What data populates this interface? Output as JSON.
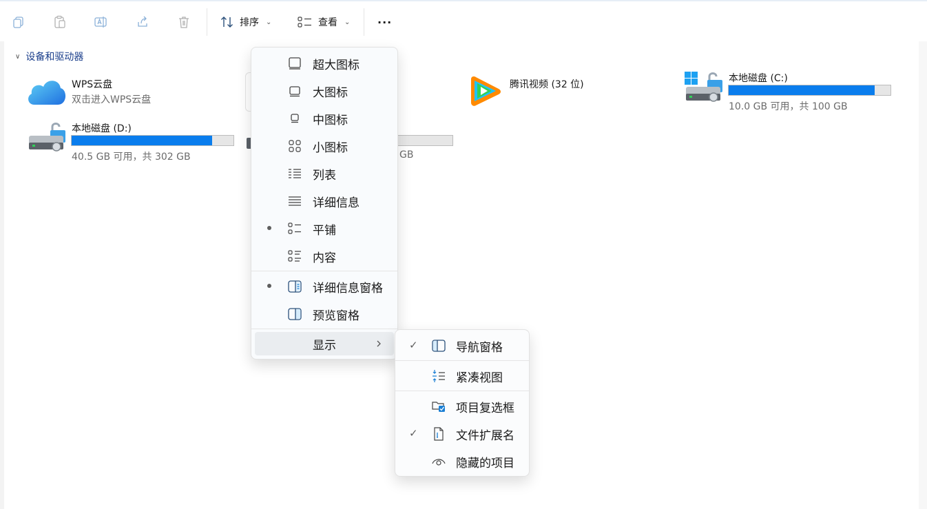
{
  "toolbar": {
    "sort_label": "排序",
    "view_label": "查看",
    "more_label": "···"
  },
  "section": {
    "title": "设备和驱动器"
  },
  "drives": [
    {
      "name": "WPS云盘",
      "sub": "双击进入WPS云盘"
    },
    {
      "name": "腾讯视频 (32 位)"
    },
    {
      "name": "本地磁盘 (C:)",
      "sub": "10.0 GB 可用，共 100 GB",
      "used_fraction": 0.9
    },
    {
      "name": "本地磁盘 (D:)",
      "sub": "40.5 GB 可用，共 302 GB",
      "used_fraction": 0.866
    },
    {
      "sub_fragment": "GB"
    }
  ],
  "view_menu": {
    "items": [
      {
        "label": "超大图标",
        "icon": "extra-large-icons-icon"
      },
      {
        "label": "大图标",
        "icon": "large-icons-icon"
      },
      {
        "label": "中图标",
        "icon": "medium-icons-icon"
      },
      {
        "label": "小图标",
        "icon": "small-icons-icon"
      },
      {
        "label": "列表",
        "icon": "list-icon"
      },
      {
        "label": "详细信息",
        "icon": "details-icon"
      },
      {
        "label": "平铺",
        "icon": "tiles-icon",
        "selected": true
      },
      {
        "label": "内容",
        "icon": "content-icon"
      },
      {
        "label": "详细信息窗格",
        "icon": "details-pane-icon",
        "selected": true
      },
      {
        "label": "预览窗格",
        "icon": "preview-pane-icon"
      },
      {
        "label": "显示",
        "icon": "chevron-right-icon",
        "highlighted": true
      }
    ]
  },
  "show_submenu": {
    "items": [
      {
        "label": "导航窗格",
        "icon": "navigation-pane-icon",
        "checked": true
      },
      {
        "label": "紧凑视图",
        "icon": "compact-view-icon",
        "checked": false
      },
      {
        "label": "项目复选框",
        "icon": "item-checkboxes-icon",
        "checked": false
      },
      {
        "label": "文件扩展名",
        "icon": "file-extensions-icon",
        "checked": true
      },
      {
        "label": "隐藏的项目",
        "icon": "hidden-items-icon",
        "checked": false
      }
    ],
    "check_glyph": "✓"
  },
  "colors": {
    "accent": "#0a7ded",
    "section_title": "#1b3f8c"
  }
}
